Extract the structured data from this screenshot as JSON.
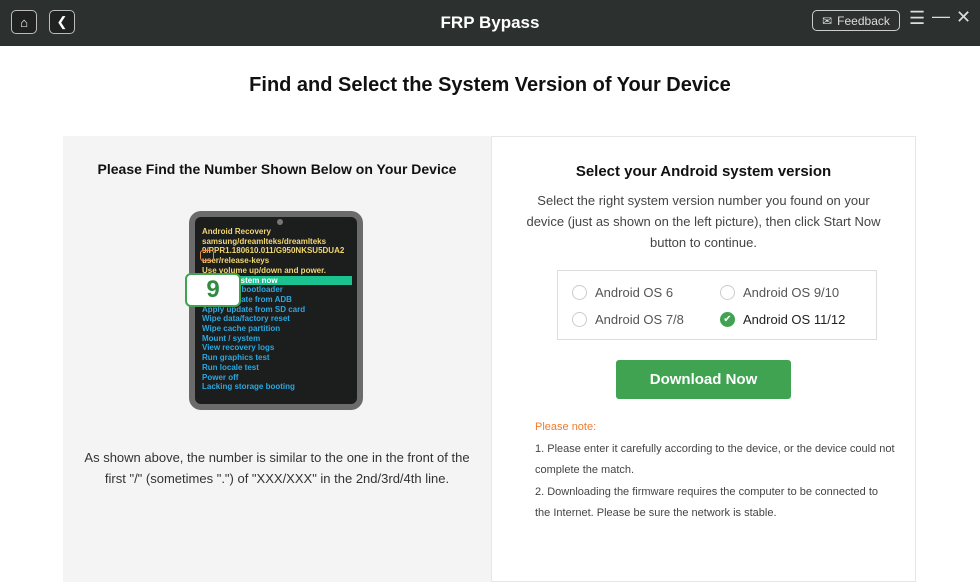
{
  "header": {
    "title": "FRP Bypass",
    "feedback": "Feedback",
    "home_icon": "home-icon",
    "back_icon": "chevron-left-icon"
  },
  "page_title": "Find and Select the System Version of Your Device",
  "left": {
    "heading": "Please Find the Number Shown Below on Your Device",
    "phone": {
      "lines_yellow": [
        "Android Recovery",
        "samsung/dreamlteks/dreamlteks",
        "9/PPR1.180610.011/G950NKSU5DUA2",
        "user/release-keys",
        "Use volume up/down and power."
      ],
      "highlight": "Reboot system now",
      "lines_blue": [
        "Reboot to bootloader",
        "Apply update from ADB",
        "Apply update from SD card",
        "Wipe data/factory reset",
        "Wipe cache partition",
        "Mount / system",
        "View recovery logs",
        "Run graphics test",
        "Run locale test",
        "Power off",
        "Lacking storage booting"
      ],
      "badge": "9"
    },
    "description": "As shown above, the number is similar to the one in the front of the first \"/\" (sometimes \".\") of \"XXX/XXX\" in the 2nd/3rd/4th line."
  },
  "right": {
    "heading": "Select your Android system version",
    "description": "Select the right system version number you found on your device (just as shown on the left picture), then click Start Now button to continue.",
    "options": [
      {
        "label": "Android OS 6",
        "selected": false
      },
      {
        "label": "Android OS 9/10",
        "selected": false
      },
      {
        "label": "Android OS 7/8",
        "selected": false
      },
      {
        "label": "Android OS 11/12",
        "selected": true
      }
    ],
    "download": "Download Now",
    "note_title": "Please note:",
    "notes": [
      "1. Please enter it carefully according to the device, or the device could not complete the match.",
      "2. Downloading the firmware requires the computer to be connected to the Internet. Please be sure the network is stable."
    ]
  },
  "colors": {
    "accent": "#3fa351",
    "note": "#f07a2c",
    "topbar": "#2c302e"
  }
}
